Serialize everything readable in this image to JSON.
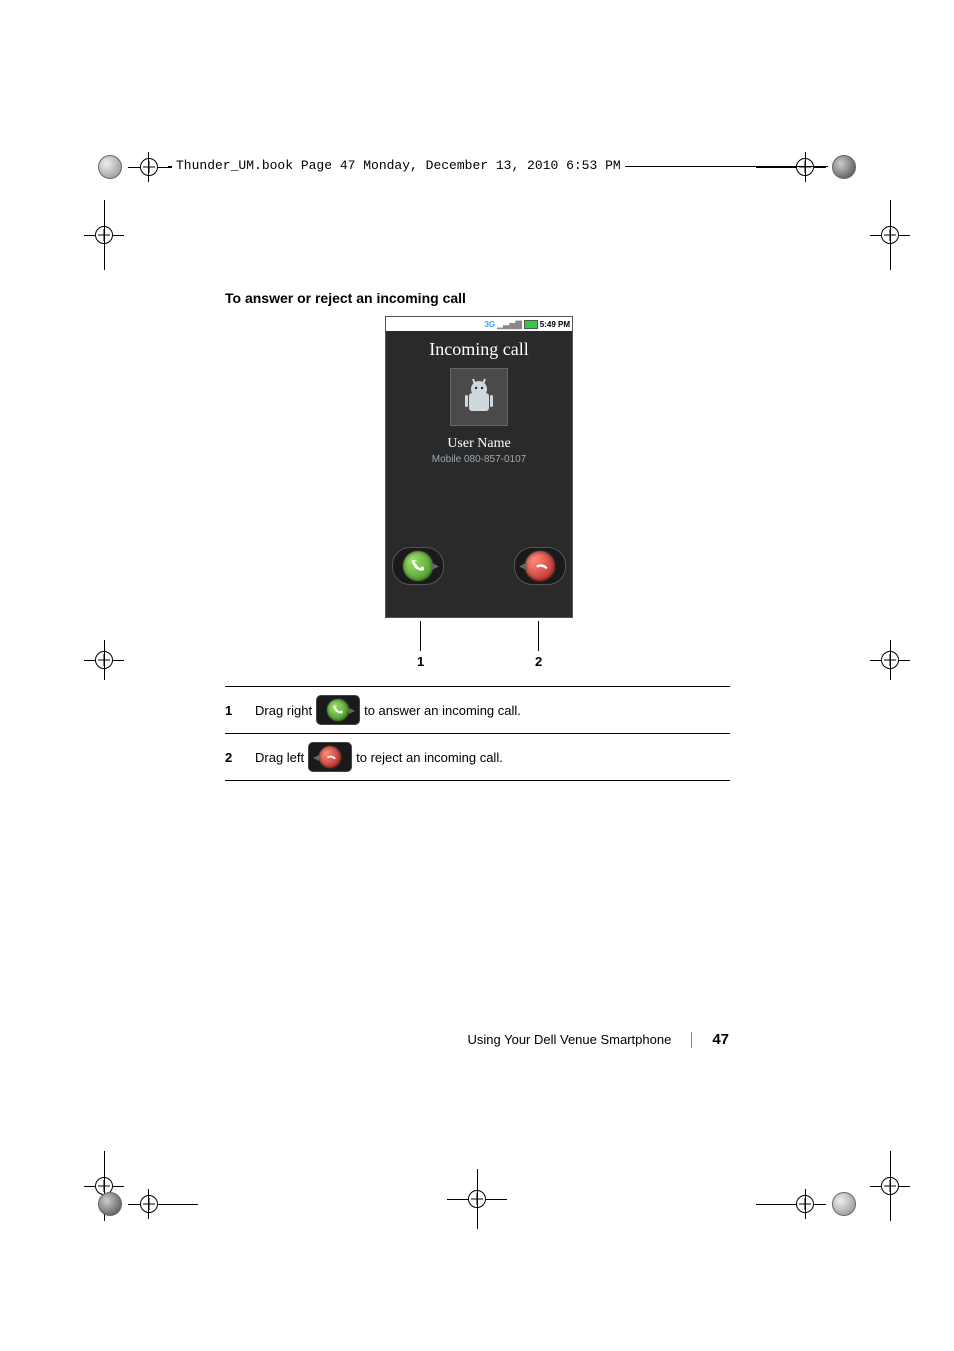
{
  "header": {
    "running_head": "Thunder_UM.book  Page 47  Monday, December 13, 2010  6:53 PM"
  },
  "section": {
    "title": "To answer or reject an incoming call"
  },
  "phone": {
    "status_time": "5:49 PM",
    "signal_label": "3G",
    "title": "Incoming call",
    "caller_name": "User Name",
    "caller_detail": "Mobile 080-857-0107"
  },
  "callouts": {
    "c1": "1",
    "c2": "2"
  },
  "table": [
    {
      "num": "1",
      "pre": "Drag right",
      "icon": "green",
      "post": "to answer an incoming call."
    },
    {
      "num": "2",
      "pre": "Drag left",
      "icon": "red",
      "post": "to reject an incoming call."
    }
  ],
  "footer": {
    "chapter": "Using Your Dell Venue Smartphone",
    "page": "47"
  }
}
